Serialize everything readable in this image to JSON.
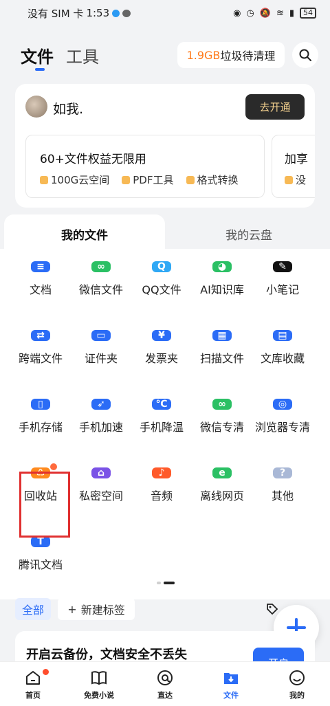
{
  "status_bar": {
    "carrier": "没有 SIM 卡",
    "time": "1:53",
    "battery": "54"
  },
  "header": {
    "tabs": [
      {
        "label": "文件"
      },
      {
        "label": "工具"
      }
    ],
    "junk": {
      "size": "1.9GB",
      "text": "垃圾待清理"
    }
  },
  "user": {
    "name": "如我.",
    "open_button": "去开通",
    "benefit": {
      "title": "60+文件权益无限用",
      "features": [
        "100G云空间",
        "PDF工具",
        "格式转换"
      ]
    },
    "benefit2": {
      "title": "加享",
      "sub": "没"
    }
  },
  "sections": {
    "my_files": "我的文件",
    "my_cloud": "我的云盘"
  },
  "grid": [
    {
      "label": "文档",
      "color": "#2b6cf6",
      "glyph": "≡"
    },
    {
      "label": "微信文件",
      "color": "#2bc064",
      "glyph": "∞"
    },
    {
      "label": "QQ文件",
      "color": "#2fa8f5",
      "glyph": "Q"
    },
    {
      "label": "AI知识库",
      "color": "#2bc064",
      "glyph": "◕"
    },
    {
      "label": "小笔记",
      "color": "#111111",
      "glyph": "✎"
    },
    {
      "label": "跨端文件",
      "color": "#2b6cf6",
      "glyph": "⇄"
    },
    {
      "label": "证件夹",
      "color": "#2b6cf6",
      "glyph": "▭"
    },
    {
      "label": "发票夹",
      "color": "#2b6cf6",
      "glyph": "¥"
    },
    {
      "label": "扫描文件",
      "color": "#2b6cf6",
      "glyph": "▦"
    },
    {
      "label": "文库收藏",
      "color": "#2b6cf6",
      "glyph": "▤"
    },
    {
      "label": "手机存储",
      "color": "#2b6cf6",
      "glyph": "▯"
    },
    {
      "label": "手机加速",
      "color": "#2b6cf6",
      "glyph": "➶"
    },
    {
      "label": "手机降温",
      "color": "#2b6cf6",
      "glyph": "℃"
    },
    {
      "label": "微信专清",
      "color": "#2bc064",
      "glyph": "∞"
    },
    {
      "label": "浏览器专清",
      "color": "#2b6cf6",
      "glyph": "◎"
    },
    {
      "label": "回收站",
      "color": "#ff8a1e",
      "glyph": "♺",
      "badge": true
    },
    {
      "label": "私密空间",
      "color": "#7a52e6",
      "glyph": "⌂"
    },
    {
      "label": "音频",
      "color": "#ff5a2a",
      "glyph": "♪"
    },
    {
      "label": "离线网页",
      "color": "#2bc064",
      "glyph": "e"
    },
    {
      "label": "其他",
      "color": "#a9b8d6",
      "glyph": "?"
    },
    {
      "label": "腾讯文档",
      "color": "#2b6cf6",
      "glyph": "T"
    }
  ],
  "tags": {
    "all": "全部",
    "new_tag": "新建标签"
  },
  "backup": {
    "title": "开启云备份，文档安全不丢失",
    "button": "开启"
  },
  "bottom_nav": [
    {
      "label": "首页"
    },
    {
      "label": "免费小说"
    },
    {
      "label": "直达"
    },
    {
      "label": "文件"
    },
    {
      "label": "我的"
    }
  ]
}
